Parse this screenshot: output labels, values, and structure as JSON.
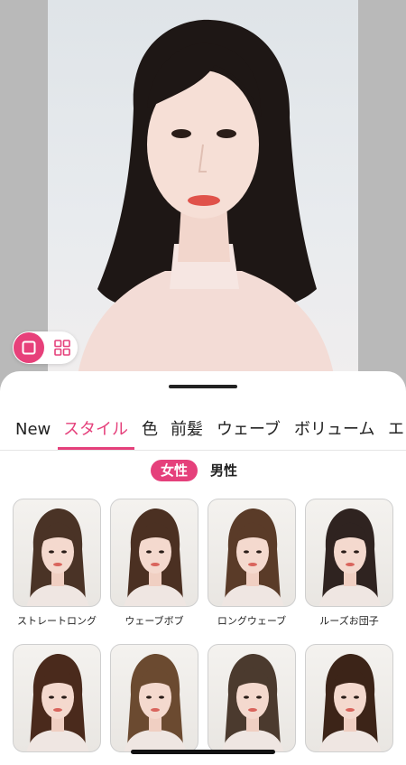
{
  "tabs": [
    {
      "label": "New",
      "active": false
    },
    {
      "label": "スタイル",
      "active": true
    },
    {
      "label": "色",
      "active": false
    },
    {
      "label": "前髪",
      "active": false
    },
    {
      "label": "ウェーブ",
      "active": false
    },
    {
      "label": "ボリューム",
      "active": false
    },
    {
      "label": "エ",
      "active": false
    }
  ],
  "gender": {
    "female": "女性",
    "male": "男性",
    "selected": "female"
  },
  "styles": [
    {
      "label": "ストレートロング",
      "hair_color": "#4a3326"
    },
    {
      "label": "ウェーブボブ",
      "hair_color": "#4b3022"
    },
    {
      "label": "ロングウェーブ",
      "hair_color": "#5a3b28"
    },
    {
      "label": "ルーズお団子",
      "hair_color": "#2f2320"
    },
    {
      "label": "",
      "hair_color": "#4a2a1c"
    },
    {
      "label": "",
      "hair_color": "#6b4a30"
    },
    {
      "label": "",
      "hair_color": "#4b3a2e"
    },
    {
      "label": "",
      "hair_color": "#3c2418"
    }
  ],
  "colors": {
    "accent": "#e5407b"
  },
  "icons": {
    "single_view": "square-icon",
    "grid_view": "grid-icon"
  }
}
